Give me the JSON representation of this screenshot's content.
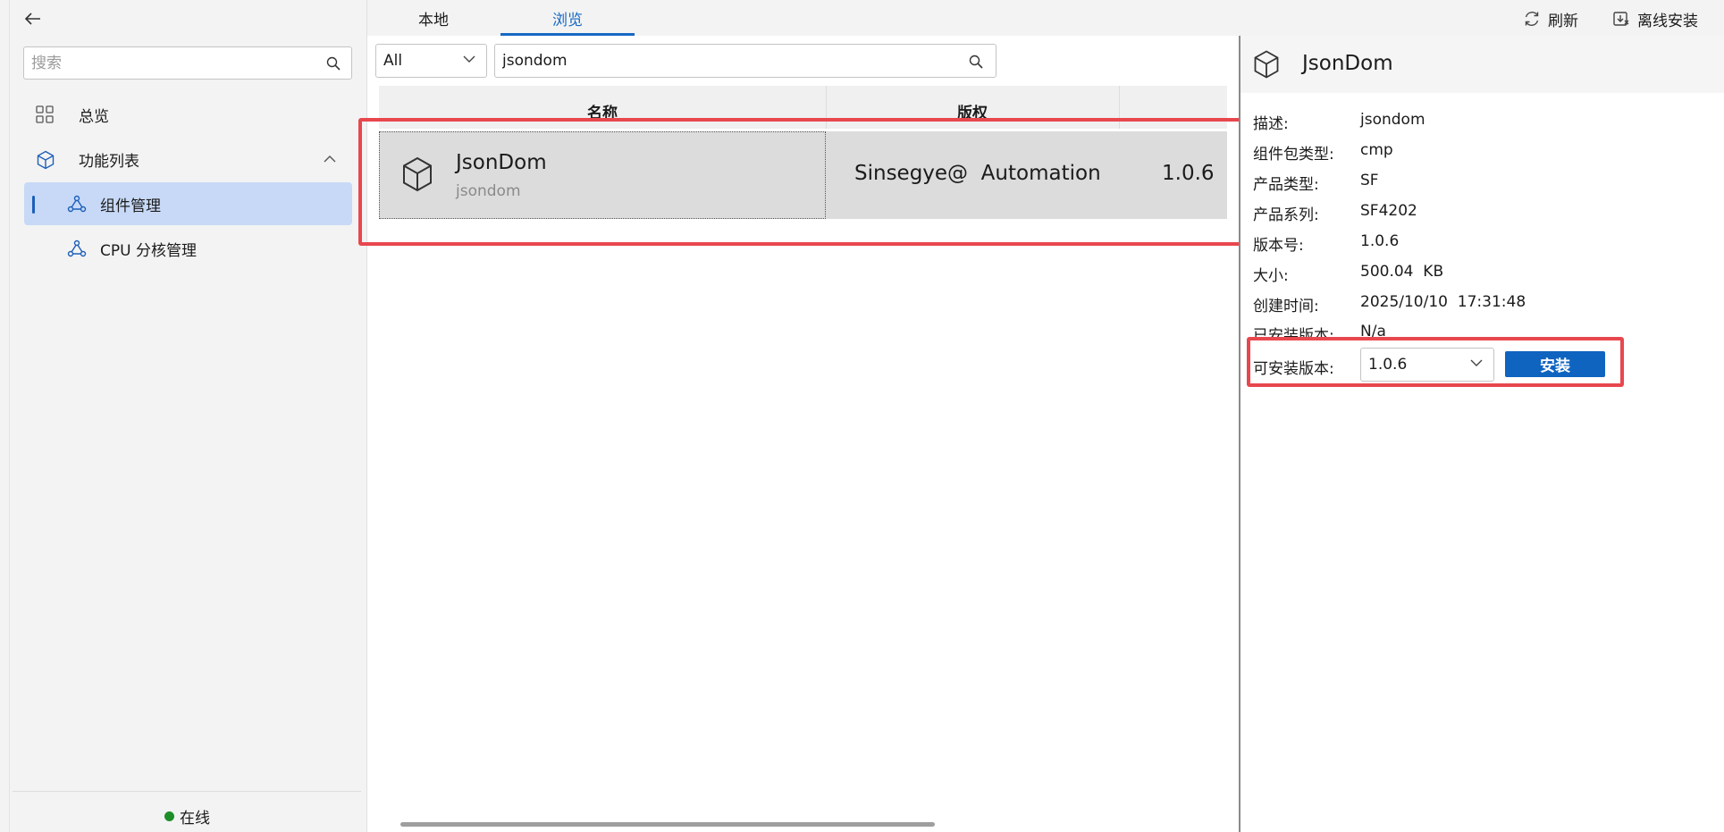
{
  "sidebar": {
    "search_placeholder": "搜索",
    "items": [
      {
        "label": "总览",
        "icon": "grid-icon"
      },
      {
        "label": "功能列表",
        "icon": "cube-icon",
        "expanded": true
      },
      {
        "label": "组件管理",
        "icon": "network-icon",
        "active": true
      },
      {
        "label": "CPU 分核管理",
        "icon": "network-icon"
      }
    ],
    "status": {
      "label": "在线",
      "color": "#1e8e29"
    }
  },
  "tabs": [
    {
      "label": "本地"
    },
    {
      "label": "浏览",
      "active": true
    }
  ],
  "toolbar": {
    "refresh_label": "刷新",
    "offline_install_label": "离线安装"
  },
  "filter": {
    "selected": "All"
  },
  "search": {
    "value": "jsondom"
  },
  "table": {
    "headers": [
      "名称",
      "版权",
      ""
    ],
    "rows": [
      {
        "name": "JsonDom",
        "subname": "jsondom",
        "copyright": "Sinsegye@  Automation",
        "version": "1.0.6",
        "selected": true
      }
    ]
  },
  "detail": {
    "title": "JsonDom",
    "fields": [
      {
        "key": "描述:",
        "value": "jsondom"
      },
      {
        "key": "组件包类型:",
        "value": "cmp"
      },
      {
        "key": "产品类型:",
        "value": "SF"
      },
      {
        "key": "产品系列:",
        "value": "SF4202"
      },
      {
        "key": "版本号:",
        "value": "1.0.6"
      },
      {
        "key": "大小:",
        "value": "500.04  KB"
      },
      {
        "key": "创建时间:",
        "value": "2025/10/10  17:31:48"
      },
      {
        "key": "已安装版本:",
        "value": "N/a"
      }
    ],
    "installable_label": "可安装版本:",
    "installable_selected": "1.0.6",
    "install_button": "安装"
  },
  "colors": {
    "accent": "#1668c5",
    "install_button": "#0f64c0",
    "highlight": "#e8474e",
    "active_nav": "#c7d9f7"
  }
}
